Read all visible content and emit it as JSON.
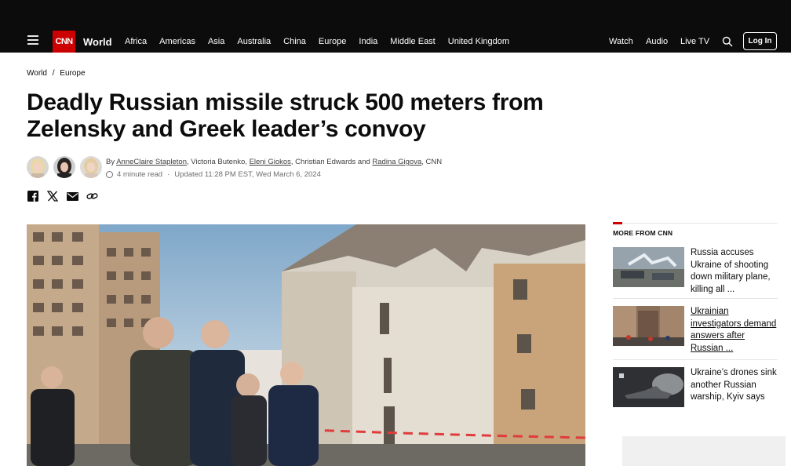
{
  "header": {
    "logo_text": "CNN",
    "section": "World",
    "nav": [
      "Africa",
      "Americas",
      "Asia",
      "Australia",
      "China",
      "Europe",
      "India",
      "Middle East",
      "United Kingdom"
    ],
    "watch": "Watch",
    "audio": "Audio",
    "live_tv": "Live TV",
    "login": "Log In"
  },
  "breadcrumb": {
    "first": "World",
    "sep": "/",
    "second": "Europe"
  },
  "article": {
    "headline": "Deadly Russian missile struck 500 meters from Zelensky and Greek leader’s convoy",
    "byline": {
      "by": "By ",
      "a1": "AnneClaire Stapleton",
      "c1": ", Victoria Butenko, ",
      "a2": "Eleni Giokos",
      "c2": ", Christian Edwards and ",
      "a3": "Radina Gigova",
      "c3": ", CNN"
    },
    "read_time": "4 minute read",
    "updated": "Updated 11:28 PM EST, Wed March 6, 2024"
  },
  "more_from": {
    "title": "MORE FROM CNN",
    "items": [
      {
        "text": "Russia accuses Ukraine of shooting down military plane, killing all ..."
      },
      {
        "text": "Ukrainian investigators demand answers after Russian ..."
      },
      {
        "text": "Ukraine’s drones sink another Russian warship, Kyiv says"
      }
    ]
  },
  "colors": {
    "brand_red": "#cc0000",
    "header_bg": "#0c0c0c"
  }
}
